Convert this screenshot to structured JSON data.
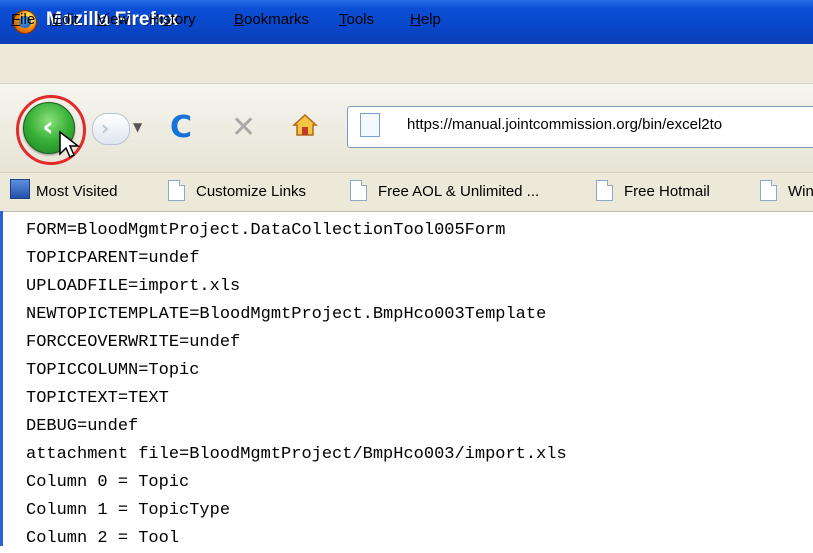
{
  "window": {
    "title": "Mozilla Firefox"
  },
  "menu": {
    "items": [
      {
        "mnemonic": "F",
        "rest": "ile"
      },
      {
        "mnemonic": "E",
        "rest": "dit"
      },
      {
        "mnemonic": "V",
        "rest": "iew"
      },
      {
        "pre": "Hi",
        "mnemonic": "s",
        "rest": "tory"
      },
      {
        "mnemonic": "B",
        "rest": "ookmarks"
      },
      {
        "mnemonic": "T",
        "rest": "ools"
      },
      {
        "mnemonic": "H",
        "rest": "elp"
      }
    ]
  },
  "nav": {
    "url": "https://manual.jointcommission.org/bin/excel2to",
    "icons": [
      "back-arrow-icon",
      "forward-arrow-icon",
      "reload-icon",
      "stop-icon",
      "home-icon"
    ],
    "highlight_color": "#e32b2b"
  },
  "bookmarks": {
    "items": [
      "Most Visited",
      "Customize Links",
      "Free AOL & Unlimited ...",
      "Free Hotmail",
      "Win"
    ]
  },
  "content": {
    "lines": [
      "FORM=BloodMgmtProject.DataCollectionTool005Form",
      "TOPICPARENT=undef",
      "UPLOADFILE=import.xls",
      "NEWTOPICTEMPLATE=BloodMgmtProject.BmpHco003Template",
      "FORCCEOVERWRITE=undef",
      "TOPICCOLUMN=Topic",
      "TOPICTEXT=TEXT",
      "DEBUG=undef",
      "attachment file=BloodMgmtProject/BmpHco003/import.xls",
      "Column 0 = Topic",
      "Column 1 = TopicType",
      "Column 2 = Tool"
    ]
  }
}
